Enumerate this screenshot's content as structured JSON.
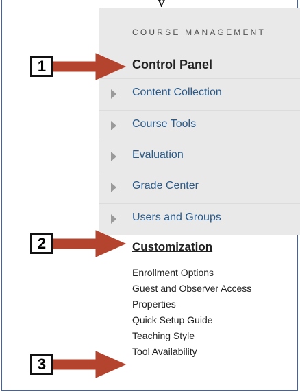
{
  "header_fragment": "y",
  "course_management": {
    "heading": "COURSE MANAGEMENT",
    "title": "Control Panel",
    "items": [
      {
        "label": "Content Collection"
      },
      {
        "label": "Course Tools"
      },
      {
        "label": "Evaluation"
      },
      {
        "label": "Grade Center"
      },
      {
        "label": "Users and Groups"
      }
    ]
  },
  "customization": {
    "title": "Customization",
    "items": [
      {
        "label": "Enrollment Options"
      },
      {
        "label": "Guest and Observer Access"
      },
      {
        "label": "Properties"
      },
      {
        "label": "Quick Setup Guide"
      },
      {
        "label": "Teaching Style"
      },
      {
        "label": "Tool Availability"
      }
    ]
  },
  "callouts": [
    {
      "number": "1"
    },
    {
      "number": "2"
    },
    {
      "number": "3"
    }
  ],
  "colors": {
    "panel_bg": "#e9e9e9",
    "link_blue": "#285b8c",
    "arrow_red": "#b5442f",
    "frame_border": "#3f63a5"
  }
}
